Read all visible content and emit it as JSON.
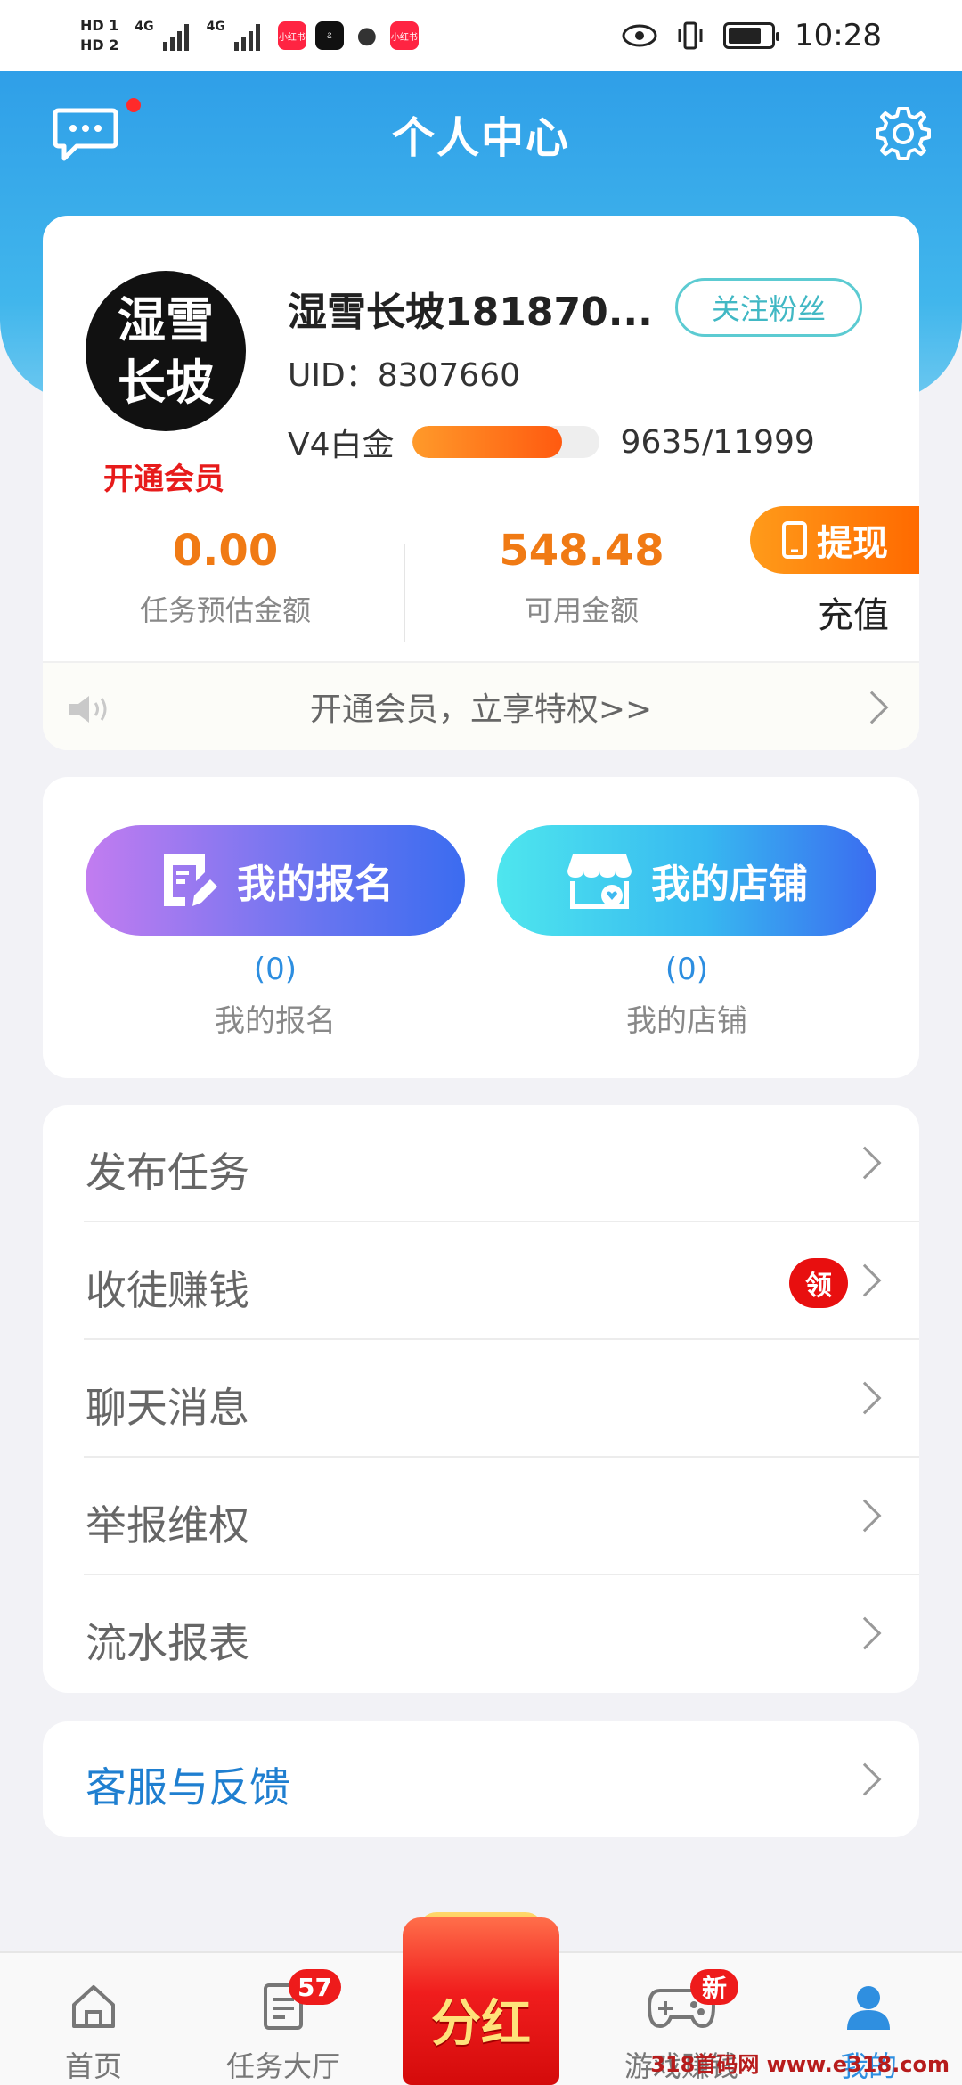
{
  "status_bar": {
    "time": "10:28",
    "hd1": "HD 1",
    "hd2": "HD 2",
    "net1": "4G",
    "net2": "4G",
    "app_icon_label": "小红书"
  },
  "header": {
    "title": "个人中心"
  },
  "profile": {
    "avatar_text_line1": "湿雪",
    "avatar_text_line2": "长坡",
    "open_vip": "开通会员",
    "username": "湿雪长坡181870...",
    "follow_label": "关注粉丝",
    "uid": "UID：8307660",
    "level_label": "V4白金",
    "level_progress": 0.8,
    "level_value": "9635/11999",
    "estimated_amount": "0.00",
    "estimated_label": "任务预估金额",
    "available_amount": "548.48",
    "available_label": "可用金额",
    "withdraw_label": "提现",
    "recharge_label": "充值",
    "notice_text": "开通会员，立享特权>>"
  },
  "actions": {
    "signup_button": "我的报名",
    "signup_count": "(0)",
    "signup_label": "我的报名",
    "shop_button": "我的店铺",
    "shop_count": "(0)",
    "shop_label": "我的店铺"
  },
  "menu": {
    "items": [
      {
        "label": "发布任务"
      },
      {
        "label": "收徒赚钱",
        "badge": "领"
      },
      {
        "label": "聊天消息"
      },
      {
        "label": "举报维权"
      },
      {
        "label": "流水报表"
      }
    ]
  },
  "service": {
    "label": "客服与反馈"
  },
  "bottom_nav": {
    "home": "首页",
    "tasks": "任务大厅",
    "tasks_badge": "57",
    "center": "分红",
    "games": "游戏赚钱",
    "games_badge": "新",
    "mine": "我的"
  },
  "watermark": "318首码网 www.e318.com",
  "colors": {
    "accent_blue": "#2f9fe8",
    "amount_orange": "#f07a14",
    "vip_red": "#e71b1b"
  }
}
